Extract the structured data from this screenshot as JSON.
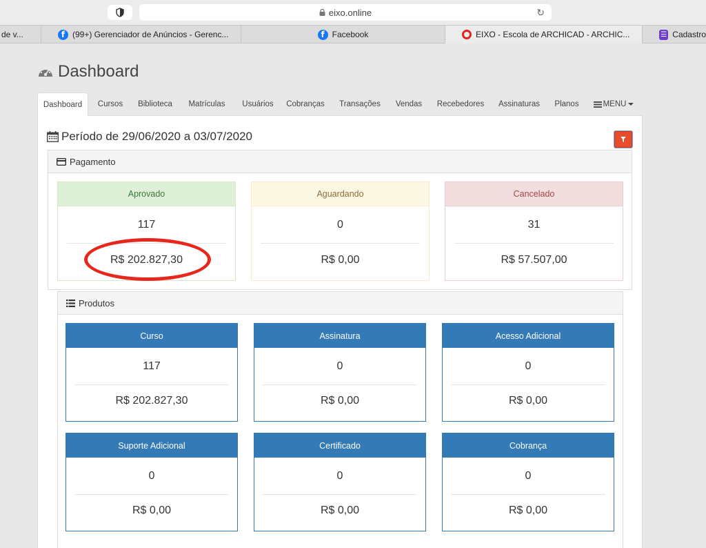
{
  "browser": {
    "url": "eixo.online",
    "tabs": [
      {
        "label": "de v...",
        "icon": "none"
      },
      {
        "label": "(99+) Gerenciador de Anúncios - Gerenc...",
        "icon": "facebook-icon"
      },
      {
        "label": "Facebook",
        "icon": "facebook-icon"
      },
      {
        "label": "EIXO - Escola de ARCHICAD - ARCHIC...",
        "icon": "eixo-icon",
        "active": true
      },
      {
        "label": "Cadastro",
        "icon": "form-icon"
      }
    ]
  },
  "header": {
    "title": "Dashboard"
  },
  "nav": {
    "items": [
      "Dashboard",
      "Cursos",
      "Biblioteca",
      "Matrículas",
      "Usuários",
      "Cobranças",
      "Transações",
      "Vendas",
      "Recebedores",
      "Assinaturas",
      "Planos"
    ],
    "menu_label": "MENU",
    "active": "Dashboard"
  },
  "periodo": {
    "label": "Período de 29/06/2020 a 03/07/2020"
  },
  "pagamento": {
    "title": "Pagamento",
    "cards": [
      {
        "title": "Aprovado",
        "count": "117",
        "amount": "R$ 202.827,30",
        "status": "success"
      },
      {
        "title": "Aguardando",
        "count": "0",
        "amount": "R$ 0,00",
        "status": "warning"
      },
      {
        "title": "Cancelado",
        "count": "31",
        "amount": "R$ 57.507,00",
        "status": "danger"
      }
    ]
  },
  "produtos": {
    "title": "Produtos",
    "cards": [
      {
        "title": "Curso",
        "count": "117",
        "amount": "R$ 202.827,30"
      },
      {
        "title": "Assinatura",
        "count": "0",
        "amount": "R$ 0,00"
      },
      {
        "title": "Acesso Adicional",
        "count": "0",
        "amount": "R$ 0,00"
      },
      {
        "title": "Suporte Adicional",
        "count": "0",
        "amount": "R$ 0,00"
      },
      {
        "title": "Certificado",
        "count": "0",
        "amount": "R$ 0,00"
      },
      {
        "title": "Cobrança",
        "count": "0",
        "amount": "R$ 0,00"
      }
    ]
  },
  "colors": {
    "primary": "#337ab7",
    "filter_button": "#e74c2b",
    "highlight_circle": "#e8261c"
  }
}
